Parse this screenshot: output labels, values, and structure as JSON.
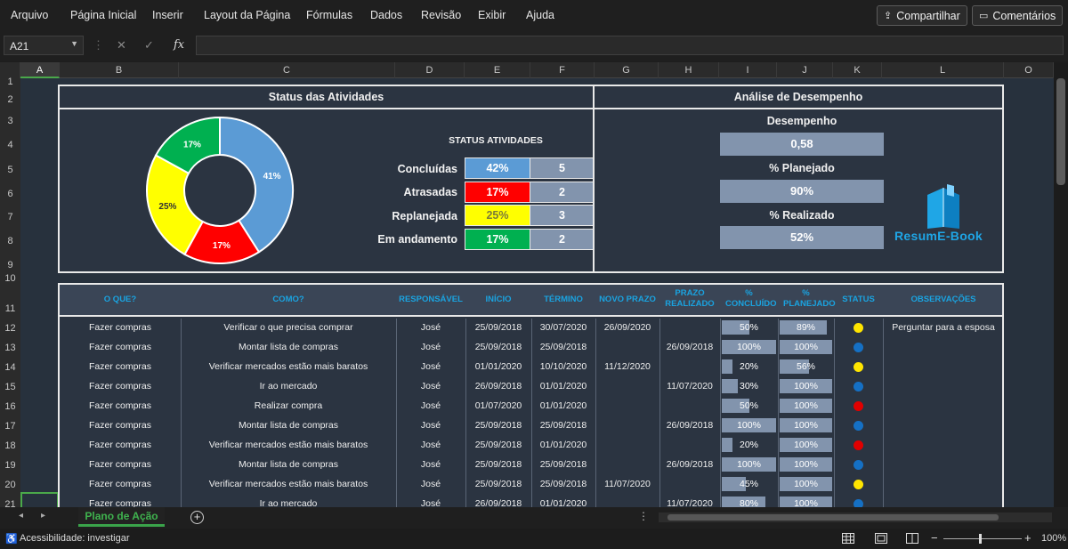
{
  "menu": [
    "Arquivo",
    "Página Inicial",
    "Inserir",
    "Layout da Página",
    "Fórmulas",
    "Dados",
    "Revisão",
    "Exibir",
    "Ajuda"
  ],
  "share_label": "Compartilhar",
  "comments_label": "Comentários",
  "name_box": "A21",
  "fx_symbol": "fx",
  "columns": [
    "A",
    "B",
    "C",
    "D",
    "E",
    "F",
    "G",
    "H",
    "I",
    "J",
    "K",
    "L",
    "O"
  ],
  "rows": [
    "1",
    "2",
    "3",
    "4",
    "5",
    "6",
    "7",
    "8",
    "9",
    "10",
    "11",
    "12",
    "13",
    "14",
    "15",
    "16",
    "17",
    "18",
    "19",
    "20",
    "21"
  ],
  "status_panel_title": "Status das Atividades",
  "perf_panel_title": "Análise de Desempenho",
  "donut": {
    "slices": [
      {
        "label": "41%",
        "value": 41,
        "color": "#5b9bd5"
      },
      {
        "label": "17%",
        "value": 17,
        "color": "#ff0000"
      },
      {
        "label": "25%",
        "value": 25,
        "color": "#ffff00"
      },
      {
        "label": "17%",
        "value": 17,
        "color": "#00b050"
      }
    ]
  },
  "status_table": {
    "title": "STATUS ATIVIDADES",
    "rows": [
      {
        "label": "Concluídas",
        "pct": "42%",
        "count": "5",
        "color": "#5b9bd5",
        "text_color": "#ffffff"
      },
      {
        "label": "Atrasadas",
        "pct": "17%",
        "count": "2",
        "color": "#ff0000",
        "text_color": "#ffffff"
      },
      {
        "label": "Replanejada",
        "pct": "25%",
        "count": "3",
        "color": "#ffff00",
        "text_color": "#7a7a3a"
      },
      {
        "label": "Em andamento",
        "pct": "17%",
        "count": "2",
        "color": "#00b050",
        "text_color": "#ffffff"
      }
    ]
  },
  "performance": {
    "desempenho_label": "Desempenho",
    "desempenho_value": "0,58",
    "planejado_label": "% Planejado",
    "planejado_value": "90%",
    "realizado_label": "% Realizado",
    "realizado_value": "52%"
  },
  "logo_text": "ResumE-Book",
  "table_headers": [
    "O QUE?",
    "COMO?",
    "RESPONSÁVEL",
    "INÍCIO",
    "TÉRMINO",
    "NOVO PRAZO",
    "PRAZO REALIZADO",
    "% CONCLUÍDO",
    "% PLANEJADO",
    "STATUS",
    "OBSERVAÇÕES"
  ],
  "table_rows": [
    {
      "oque": "Fazer compras",
      "como": "Verificar o que precisa comprar",
      "resp": "José",
      "inicio": "25/09/2018",
      "termino": "30/07/2020",
      "novo": "26/09/2020",
      "realizado": "",
      "concl": "50%",
      "concl_v": 0.5,
      "plan": "89%",
      "plan_v": 0.89,
      "status": "#ffe500",
      "obs": "Perguntar para a esposa"
    },
    {
      "oque": "Fazer compras",
      "como": "Montar lista de compras",
      "resp": "José",
      "inicio": "25/09/2018",
      "termino": "25/09/2018",
      "novo": "",
      "realizado": "26/09/2018",
      "concl": "100%",
      "concl_v": 1.0,
      "plan": "100%",
      "plan_v": 1.0,
      "status": "#1570c4",
      "obs": ""
    },
    {
      "oque": "Fazer compras",
      "como": "Verificar mercados estão mais baratos",
      "resp": "José",
      "inicio": "01/01/2020",
      "termino": "10/10/2020",
      "novo": "11/12/2020",
      "realizado": "",
      "concl": "20%",
      "concl_v": 0.2,
      "plan": "56%",
      "plan_v": 0.56,
      "status": "#ffe500",
      "obs": ""
    },
    {
      "oque": "Fazer compras",
      "como": "Ir ao mercado",
      "resp": "José",
      "inicio": "26/09/2018",
      "termino": "01/01/2020",
      "novo": "",
      "realizado": "11/07/2020",
      "concl": "30%",
      "concl_v": 0.3,
      "plan": "100%",
      "plan_v": 1.0,
      "status": "#1570c4",
      "obs": ""
    },
    {
      "oque": "Fazer compras",
      "como": "Realizar compra",
      "resp": "José",
      "inicio": "01/07/2020",
      "termino": "01/01/2020",
      "novo": "",
      "realizado": "",
      "concl": "50%",
      "concl_v": 0.5,
      "plan": "100%",
      "plan_v": 1.0,
      "status": "#e00000",
      "obs": ""
    },
    {
      "oque": "Fazer compras",
      "como": "Montar lista de compras",
      "resp": "José",
      "inicio": "25/09/2018",
      "termino": "25/09/2018",
      "novo": "",
      "realizado": "26/09/2018",
      "concl": "100%",
      "concl_v": 1.0,
      "plan": "100%",
      "plan_v": 1.0,
      "status": "#1570c4",
      "obs": ""
    },
    {
      "oque": "Fazer compras",
      "como": "Verificar mercados estão mais baratos",
      "resp": "José",
      "inicio": "25/09/2018",
      "termino": "01/01/2020",
      "novo": "",
      "realizado": "",
      "concl": "20%",
      "concl_v": 0.2,
      "plan": "100%",
      "plan_v": 1.0,
      "status": "#e00000",
      "obs": ""
    },
    {
      "oque": "Fazer compras",
      "como": "Montar lista de compras",
      "resp": "José",
      "inicio": "25/09/2018",
      "termino": "25/09/2018",
      "novo": "",
      "realizado": "26/09/2018",
      "concl": "100%",
      "concl_v": 1.0,
      "plan": "100%",
      "plan_v": 1.0,
      "status": "#1570c4",
      "obs": ""
    },
    {
      "oque": "Fazer compras",
      "como": "Verificar mercados estão mais baratos",
      "resp": "José",
      "inicio": "25/09/2018",
      "termino": "25/09/2018",
      "novo": "11/07/2020",
      "realizado": "",
      "concl": "45%",
      "concl_v": 0.45,
      "plan": "100%",
      "plan_v": 1.0,
      "status": "#ffe500",
      "obs": ""
    },
    {
      "oque": "Fazer compras",
      "como": "Ir ao mercado",
      "resp": "José",
      "inicio": "26/09/2018",
      "termino": "01/01/2020",
      "novo": "",
      "realizado": "11/07/2020",
      "concl": "80%",
      "concl_v": 0.8,
      "plan": "100%",
      "plan_v": 1.0,
      "status": "#1570c4",
      "obs": ""
    }
  ],
  "sheet_tab": "Plano de Ação",
  "status_text": "Acessibilidade: investigar",
  "zoom": "100%"
}
